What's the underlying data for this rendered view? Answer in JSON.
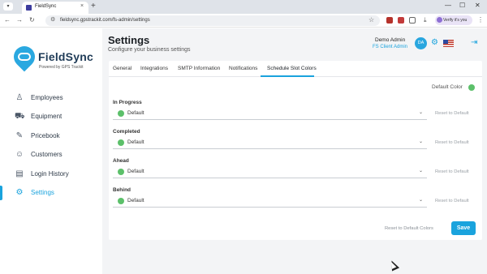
{
  "browser": {
    "tab_title": "FieldSync",
    "tab_close": "×",
    "new_tab": "+",
    "tab_menu": "▾",
    "minimize": "—",
    "maximize": "☐",
    "close": "✕",
    "back": "←",
    "forward": "→",
    "reload": "↻",
    "url": "fieldsync.gpstrackit.com/fs-admin/settings",
    "site_info_icon": "⚙",
    "bookmark_icon": "☆",
    "verify_label": "Verify it's you",
    "download_icon": "⤓",
    "menu_icon": "⋮"
  },
  "brand": {
    "name": "FieldSync",
    "tagline": "Powered by GPS Trackit"
  },
  "sidebar": {
    "items": [
      {
        "label": "Employees",
        "icon": "user-icon",
        "glyph": "♙"
      },
      {
        "label": "Equipment",
        "icon": "truck-icon",
        "glyph": "⛟"
      },
      {
        "label": "Pricebook",
        "icon": "wrench-icon",
        "glyph": "✎"
      },
      {
        "label": "Customers",
        "icon": "users-icon",
        "glyph": "☺"
      },
      {
        "label": "Login History",
        "icon": "document-icon",
        "glyph": "▤"
      },
      {
        "label": "Settings",
        "icon": "gear-icon",
        "glyph": "⚙",
        "active": true
      }
    ]
  },
  "header": {
    "title": "Settings",
    "subtitle": "Configure your business settings",
    "user_name": "Demo Admin",
    "user_role": "FS Client Admin",
    "avatar_initials": "DA",
    "gear_glyph": "⚙",
    "logout_glyph": "⇥"
  },
  "tabs": [
    {
      "label": "General"
    },
    {
      "label": "Integrations"
    },
    {
      "label": "SMTP Information"
    },
    {
      "label": "Notifications"
    },
    {
      "label": "Schedule Slot Colors",
      "active": true
    }
  ],
  "schedule_colors": {
    "default_color_label": "Default Color",
    "default_color": "#5cc06a",
    "rows": [
      {
        "label": "In Progress",
        "value": "Default",
        "reset": "Reset to Default"
      },
      {
        "label": "Completed",
        "value": "Default",
        "reset": "Reset to Default"
      },
      {
        "label": "Ahead",
        "value": "Default",
        "reset": "Reset to Default"
      },
      {
        "label": "Behind",
        "value": "Default",
        "reset": "Reset to Default"
      }
    ],
    "chevron": "⌄",
    "reset_all_label": "Reset to Default Colors",
    "save_label": "Save"
  },
  "colors": {
    "accent": "#1aa3dd",
    "brand_dark": "#1f3b57",
    "status_green": "#5cc06a"
  }
}
